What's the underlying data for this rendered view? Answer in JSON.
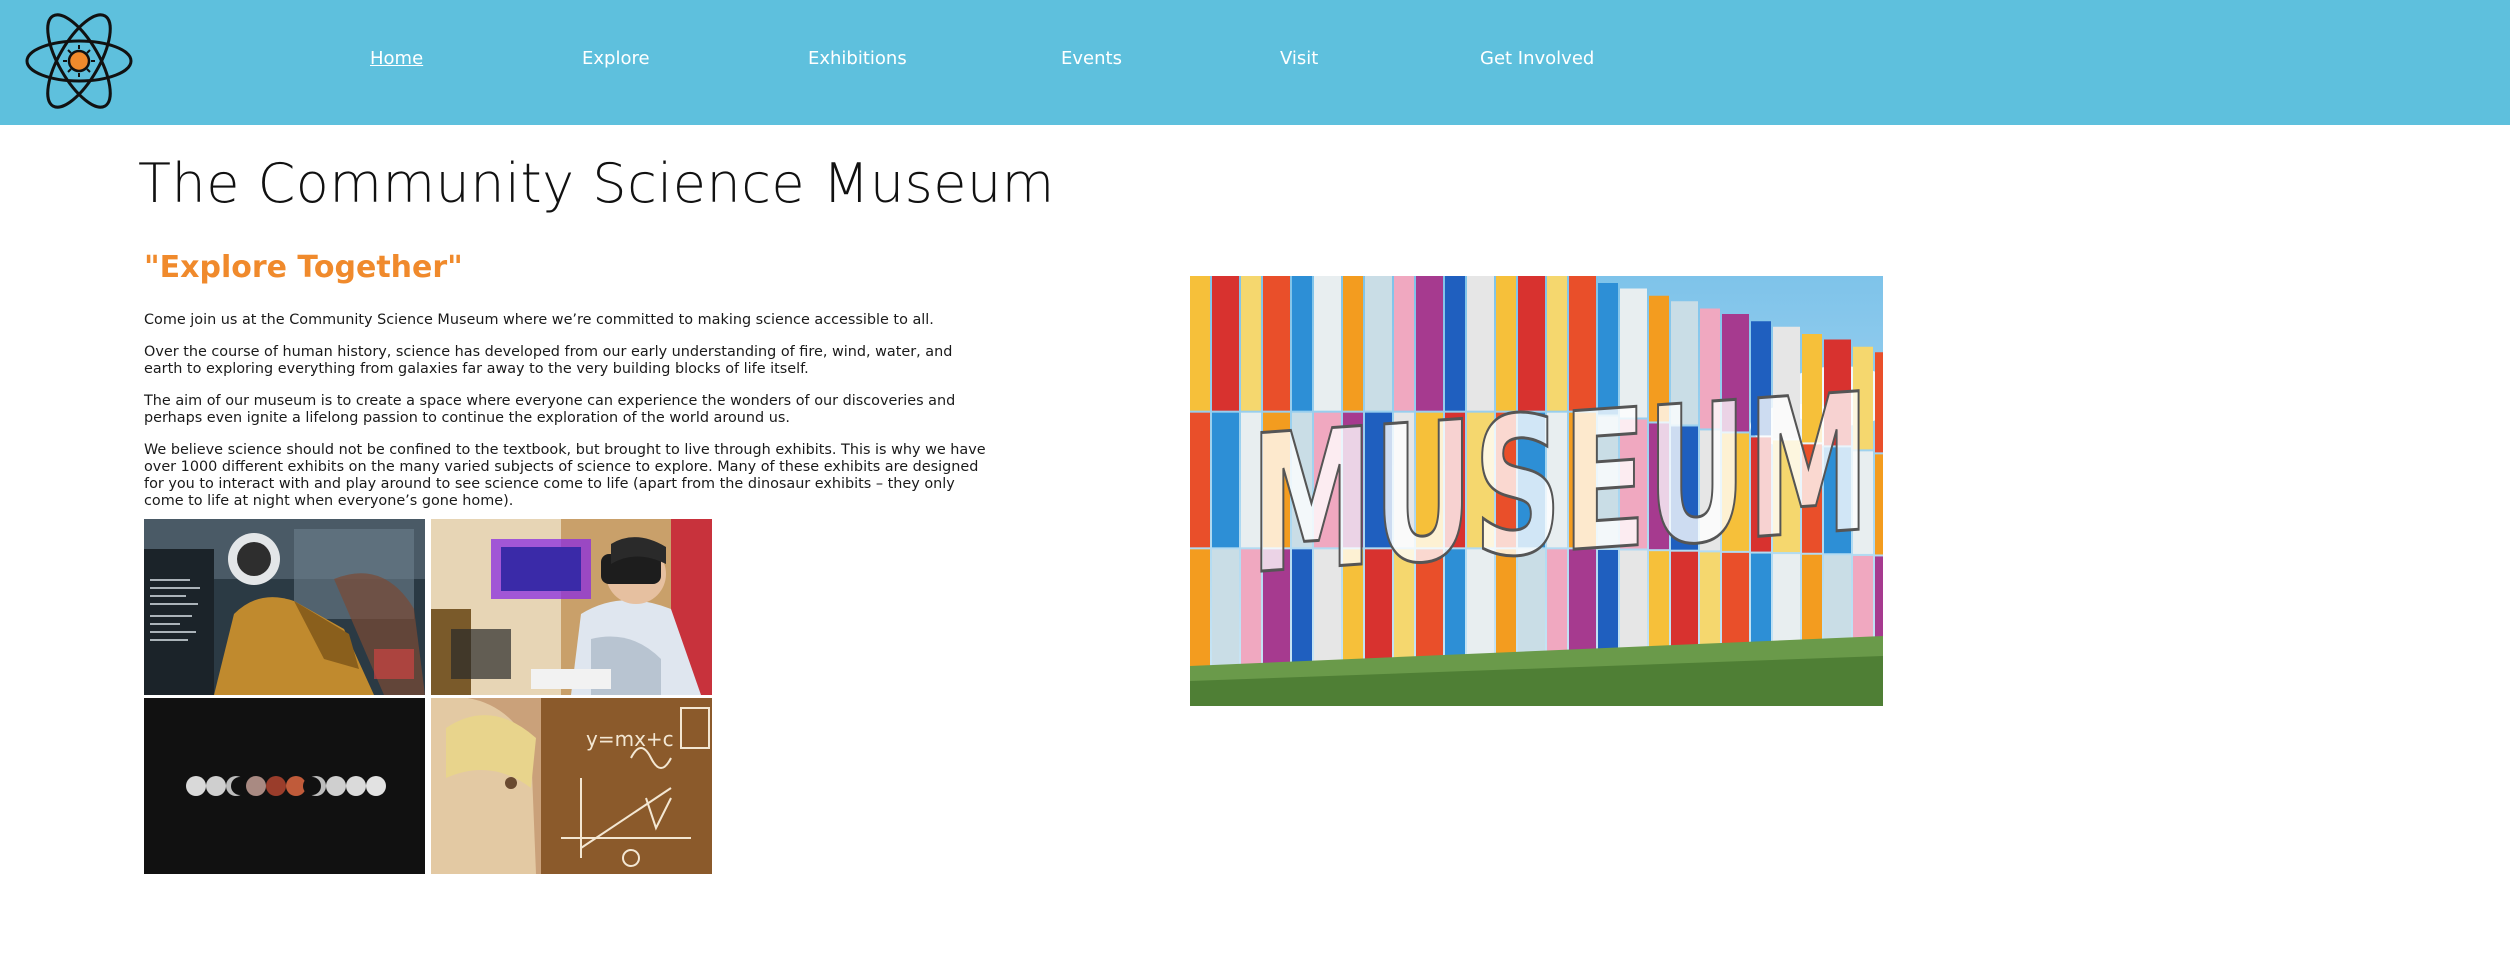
{
  "nav": {
    "items": [
      {
        "label": "Home",
        "active": true
      },
      {
        "label": "Explore",
        "active": false
      },
      {
        "label": "Exhibitions",
        "active": false
      },
      {
        "label": "Events",
        "active": false
      },
      {
        "label": "Visit",
        "active": false
      },
      {
        "label": "Get Involved",
        "active": false
      }
    ],
    "background": "#5ec0dd",
    "logo_icon": "atom-icon"
  },
  "main": {
    "title": "The Community Science Museum",
    "tagline": "\"Explore Together\"",
    "tagline_color": "#f08a2c",
    "paragraphs": [
      "Come join us at the Community Science Museum where we’re committed to making science accessible to all.",
      "Over the course of human history, science has developed from our early understanding of fire, wind, water, and earth to exploring everything from galaxies far away to the very building blocks of life itself.",
      "The aim of our museum is to create a space where everyone can experience the wonders of our discoveries and perhaps even ignite a lifelong passion to continue the exploration of the world around us.",
      "We believe science should not be confined to the textbook, but brought to live through exhibits. This is why we have over 1000 different exhibits on the many varied subjects of science to explore. Many of these exhibits are designed for you to interact with and play around to see science come to life (apart from the dinosaur exhibits – they only come to life at night when everyone’s gone home)."
    ]
  },
  "gallery": {
    "images": [
      {
        "icon": "astronaut-suit-photo"
      },
      {
        "icon": "vr-headset-photo"
      },
      {
        "icon": "moon-phases-photo"
      },
      {
        "icon": "chalkboard-equations-photo"
      }
    ],
    "chalkboard_text": "y=mx+c"
  },
  "hero": {
    "icon": "museum-sign-photo",
    "sign_text": "MUSEUM"
  }
}
